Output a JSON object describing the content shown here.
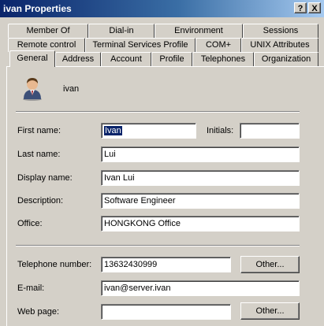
{
  "window": {
    "title": "ivan Properties",
    "help_label": "?",
    "close_label": "X"
  },
  "tabs": {
    "row1": [
      "Member Of",
      "Dial-in",
      "Environment",
      "Sessions"
    ],
    "row2": [
      "Remote control",
      "Terminal Services Profile",
      "COM+",
      "UNIX Attributes"
    ],
    "row3": [
      "General",
      "Address",
      "Account",
      "Profile",
      "Telephones",
      "Organization"
    ],
    "active": "General"
  },
  "user": {
    "name": "ivan",
    "icon": "user-icon"
  },
  "form": {
    "first_name_label": "First name:",
    "first_name_value": "Ivan",
    "initials_label": "Initials:",
    "initials_value": "",
    "last_name_label": "Last name:",
    "last_name_value": "Lui",
    "display_name_label": "Display name:",
    "display_name_value": "Ivan Lui",
    "description_label": "Description:",
    "description_value": "Software Engineer",
    "office_label": "Office:",
    "office_value": "HONGKONG Office",
    "telephone_label": "Telephone number:",
    "telephone_value": "13632430999",
    "email_label": "E-mail:",
    "email_value": "ivan@server.ivan",
    "webpage_label": "Web page:",
    "webpage_value": "",
    "other_label": "Other..."
  }
}
